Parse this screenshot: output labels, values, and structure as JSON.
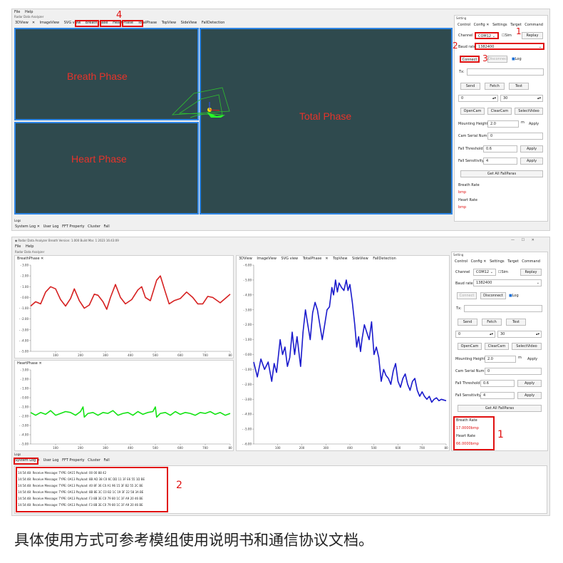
{
  "top": {
    "menu": [
      "File",
      "Help"
    ],
    "subtitle": "Radar Data Analyzer",
    "tabs": [
      "3DView",
      "ImageView",
      "SVG view",
      "BreathPhase",
      "HeartPhase",
      "TotalPhase",
      "TopView",
      "SideView",
      "FallDetection"
    ],
    "canvas_labels": {
      "breath": "Breath Phase",
      "heart": "Heart Phase",
      "total": "Total Phase"
    },
    "ann": {
      "n1": "1",
      "n2": "2",
      "n3": "3",
      "n4": "4"
    },
    "right": {
      "title": "Setting",
      "tabs": [
        "Control",
        "Config",
        "Settings",
        "Target",
        "Command"
      ],
      "channel_label": "Channel",
      "channel_value": "COM12",
      "sim": "Sim",
      "replay": "Replay",
      "baud_label": "Baud rate",
      "baud_value": "1382400",
      "connect": "Connect",
      "disconnect": "Disconnect",
      "log": "Log",
      "tx": "Tx:",
      "send": "Send",
      "fetch": "Fetch",
      "test": "Test",
      "num1": "0",
      "num2": "30",
      "opencam": "OpenCam",
      "clearcam": "ClearCam",
      "selectvideo": "SelectVideo",
      "mount_label": "Mounting Height",
      "mount_value": "2.0",
      "mount_unit": "m",
      "apply": "Apply",
      "camserial_label": "Cam Serial Num",
      "camserial_value": "0",
      "fallth_label": "Fall Threshold",
      "fallth_value": "0.6",
      "fallsens_label": "Fall Sensitivity",
      "fallsens_value": "4",
      "getall": "Get All FallParas",
      "breath_rate": "Breath Rate",
      "breath_unit": "bmp",
      "heart_rate": "Heart Rate",
      "heart_unit": "bmp"
    },
    "logs_title": "Logs",
    "log_tabs": [
      "System Log",
      "User Log",
      "FFT Property",
      "Cluster",
      "Fall"
    ]
  },
  "bottom": {
    "window_title": "Radar Data Analyzer Breath Version: 1.000 Build Mar. 1 2023 16:43:09",
    "menu": [
      "File",
      "Help"
    ],
    "subtitle": "Radar Data Analyzer",
    "breath_tab": "BreathPhase",
    "heart_tab": "HeartPhase",
    "center_tabs": [
      "3DView",
      "ImageView",
      "SVG view",
      "TotalPhase",
      "TopView",
      "SideView",
      "FallDetection"
    ],
    "yticks_breath": [
      "3.00",
      "2.00",
      "1.00",
      "0.00",
      "-1.00",
      "-2.00",
      "-3.00",
      "-4.00",
      "-5.00"
    ],
    "yticks_heart": [
      "3.00",
      "2.00",
      "1.00",
      "0.00",
      "-1.00",
      "-2.00",
      "-3.00",
      "-4.00",
      "-5.00"
    ],
    "yticks_total": [
      "6.00",
      "5.00",
      "4.00",
      "3.00",
      "2.00",
      "1.00",
      "0.00",
      "-1.00",
      "-2.00",
      "-3.00",
      "-4.00",
      "-5.00",
      "-6.00"
    ],
    "xticks": [
      "100",
      "200",
      "300",
      "400",
      "500",
      "600",
      "700",
      "80"
    ],
    "xticks_total": [
      "100",
      "200",
      "300",
      "400",
      "500",
      "600",
      "700",
      "80"
    ],
    "right": {
      "title": "Setting",
      "tabs": [
        "Control",
        "Config",
        "Settings",
        "Target",
        "Command"
      ],
      "channel_label": "Channel",
      "channel_value": "COM12",
      "sim": "Sim",
      "replay": "Replay",
      "baud_label": "Baud rate",
      "baud_value": "1382400",
      "connect": "Connect",
      "disconnect": "Disconnect",
      "log": "Log",
      "tx": "Tx:",
      "send": "Send",
      "fetch": "Fetch",
      "test": "Test",
      "num1": "0",
      "num2": "30",
      "opencam": "OpenCam",
      "clearcam": "ClearCam",
      "selectvideo": "SelectVideo",
      "mount_label": "Mounting Height",
      "mount_value": "2.0",
      "mount_unit": "m",
      "apply": "Apply",
      "camserial_label": "Cam Serial Num",
      "camserial_value": "0",
      "fallth_label": "Fall Threshold",
      "fallth_value": "0.6",
      "fallsens_label": "Fall Sensitivity",
      "fallsens_value": "4",
      "getall": "Get All FallParas",
      "breath_rate": "Breath Rate",
      "breath_value": "17.0000bmp",
      "heart_rate": "Heart Rate",
      "heart_value": "66.0000bmp"
    },
    "ann": {
      "n1": "1",
      "n2": "2"
    },
    "logs_title": "Logs",
    "log_tabs": [
      "System Log",
      "User Log",
      "FFT Property",
      "Cluster",
      "Fall"
    ],
    "log_lines": [
      "14:54:48: Receive Message: TYPE: 0A15 Payload: 00 00 88 42",
      "14:54:48: Receive Message: TYPE: 0A13 Payload: 8B AD 38 C0 6C DD 11 3F E6 55 1D BE",
      "14:54:48: Receive Message: TYPE: 0A13 Payload: 40 8F 36 C0 A1 96 15 3F B2 55 2C BE",
      "14:54:48: Receive Message: TYPE: 0A13 Payload: 8B 8E 3C C0 B2 1C 19 3F 22 58 3A BE",
      "14:54:48: Receive Message: TYPE: 0A13 Payload: F3 8B 3E C0 79 80 1C 3F A9 20 46 BE",
      "14:54:48: Receive Message: TYPE: 0A13 Payload: F3 8B 3E C0 79 80 1C 3F A9 20 46 BE"
    ]
  },
  "caption": "具体使用方式可参考模组使用说明书和通信协议文档。",
  "colors": {
    "breath_line": "#d62020",
    "heart_line": "#13e313",
    "total_line": "#1a1acc",
    "canvas_bg": "#2f4a4e",
    "highlight": "#2f86e6",
    "annotation": "#e01010"
  },
  "chart_data": [
    {
      "type": "line",
      "title": "",
      "ylim": [
        -5,
        3
      ],
      "xlim": [
        0,
        800
      ],
      "xticks": [
        100,
        200,
        300,
        400,
        500,
        600,
        700,
        800
      ],
      "series": [
        {
          "values": [
            [
              0,
              -0.8
            ],
            [
              20,
              -0.4
            ],
            [
              40,
              -0.6
            ],
            [
              60,
              0.5
            ],
            [
              80,
              1.0
            ],
            [
              100,
              0.8
            ],
            [
              120,
              -0.2
            ],
            [
              140,
              -0.8
            ],
            [
              160,
              -0.1
            ],
            [
              175,
              0.8
            ],
            [
              195,
              -0.3
            ],
            [
              215,
              -1.0
            ],
            [
              235,
              -0.7
            ],
            [
              255,
              0.3
            ],
            [
              270,
              0.2
            ],
            [
              290,
              -0.4
            ],
            [
              305,
              -1.1
            ],
            [
              320,
              0.0
            ],
            [
              340,
              1.2
            ],
            [
              360,
              0.0
            ],
            [
              380,
              -0.6
            ],
            [
              405,
              -0.2
            ],
            [
              430,
              0.7
            ],
            [
              445,
              1.0
            ],
            [
              460,
              0.0
            ],
            [
              480,
              -0.3
            ],
            [
              505,
              1.6
            ],
            [
              520,
              2.0
            ],
            [
              540,
              0.5
            ],
            [
              555,
              -0.6
            ],
            [
              575,
              -0.3
            ],
            [
              600,
              -0.1
            ],
            [
              625,
              0.5
            ],
            [
              650,
              0.0
            ],
            [
              670,
              -0.6
            ],
            [
              690,
              -0.6
            ],
            [
              710,
              0.1
            ],
            [
              730,
              0.0
            ],
            [
              760,
              -0.5
            ],
            [
              780,
              -0.1
            ],
            [
              800,
              0.3
            ]
          ]
        }
      ]
    },
    {
      "type": "line",
      "title": "",
      "ylim": [
        -5,
        3
      ],
      "xlim": [
        0,
        800
      ],
      "xticks": [
        100,
        200,
        300,
        400,
        500,
        600,
        700,
        800
      ],
      "series": [
        {
          "values": [
            [
              0,
              -1.6
            ],
            [
              20,
              -1.9
            ],
            [
              40,
              -1.6
            ],
            [
              60,
              -1.8
            ],
            [
              80,
              -1.4
            ],
            [
              100,
              -1.9
            ],
            [
              120,
              -1.7
            ],
            [
              140,
              -1.5
            ],
            [
              160,
              -1.6
            ],
            [
              180,
              -1.9
            ],
            [
              200,
              -1.5
            ],
            [
              210,
              -1.0
            ],
            [
              215,
              -2.1
            ],
            [
              230,
              -1.7
            ],
            [
              250,
              -1.6
            ],
            [
              270,
              -1.9
            ],
            [
              290,
              -1.6
            ],
            [
              310,
              -1.7
            ],
            [
              330,
              -1.4
            ],
            [
              350,
              -1.9
            ],
            [
              370,
              -1.7
            ],
            [
              390,
              -1.6
            ],
            [
              410,
              -1.9
            ],
            [
              430,
              -1.5
            ],
            [
              450,
              -1.8
            ],
            [
              470,
              -1.6
            ],
            [
              490,
              -1.5
            ],
            [
              500,
              -1.0
            ],
            [
              505,
              -2.1
            ],
            [
              520,
              -1.7
            ],
            [
              540,
              -1.6
            ],
            [
              560,
              -1.9
            ],
            [
              580,
              -1.5
            ],
            [
              600,
              -1.8
            ],
            [
              620,
              -1.6
            ],
            [
              640,
              -1.7
            ],
            [
              660,
              -1.9
            ],
            [
              680,
              -1.6
            ],
            [
              700,
              -1.7
            ],
            [
              720,
              -1.5
            ],
            [
              740,
              -1.8
            ],
            [
              760,
              -1.6
            ],
            [
              780,
              -1.9
            ],
            [
              800,
              -1.7
            ]
          ]
        }
      ]
    },
    {
      "type": "line",
      "title": "",
      "ylim": [
        -6,
        6
      ],
      "xlim": [
        0,
        800
      ],
      "xticks": [
        100,
        200,
        300,
        400,
        500,
        600,
        700,
        800
      ],
      "series": [
        {
          "values": [
            [
              0,
              -0.5
            ],
            [
              15,
              -1.5
            ],
            [
              30,
              -0.3
            ],
            [
              45,
              -1.0
            ],
            [
              60,
              -0.5
            ],
            [
              75,
              -1.8
            ],
            [
              85,
              -0.6
            ],
            [
              95,
              -1.2
            ],
            [
              110,
              1.0
            ],
            [
              120,
              0.0
            ],
            [
              130,
              0.5
            ],
            [
              140,
              -0.8
            ],
            [
              150,
              -0.2
            ],
            [
              160,
              1.5
            ],
            [
              170,
              0.0
            ],
            [
              180,
              1.2
            ],
            [
              195,
              -0.8
            ],
            [
              205,
              1.5
            ],
            [
              215,
              3.0
            ],
            [
              225,
              2.0
            ],
            [
              235,
              1.0
            ],
            [
              245,
              2.8
            ],
            [
              255,
              3.5
            ],
            [
              265,
              3.0
            ],
            [
              275,
              2.0
            ],
            [
              285,
              1.0
            ],
            [
              295,
              2.0
            ],
            [
              305,
              3.0
            ],
            [
              315,
              3.2
            ],
            [
              325,
              4.5
            ],
            [
              332,
              4.0
            ],
            [
              340,
              5.0
            ],
            [
              348,
              4.2
            ],
            [
              355,
              4.8
            ],
            [
              365,
              4.5
            ],
            [
              375,
              4.3
            ],
            [
              385,
              5.0
            ],
            [
              392,
              4.3
            ],
            [
              400,
              4.7
            ],
            [
              410,
              3.5
            ],
            [
              420,
              2.0
            ],
            [
              428,
              0.5
            ],
            [
              436,
              1.2
            ],
            [
              444,
              0.2
            ],
            [
              450,
              1.0
            ],
            [
              460,
              2.0
            ],
            [
              470,
              1.5
            ],
            [
              480,
              1.0
            ],
            [
              490,
              2.2
            ],
            [
              500,
              0.0
            ],
            [
              510,
              0.5
            ],
            [
              520,
              -0.2
            ],
            [
              530,
              -1.8
            ],
            [
              540,
              -1.0
            ],
            [
              550,
              -1.4
            ],
            [
              560,
              -1.6
            ],
            [
              570,
              -2.0
            ],
            [
              580,
              -1.1
            ],
            [
              590,
              -0.6
            ],
            [
              600,
              -1.8
            ],
            [
              610,
              -2.2
            ],
            [
              620,
              -1.6
            ],
            [
              630,
              -1.3
            ],
            [
              640,
              -2.0
            ],
            [
              650,
              -2.4
            ],
            [
              660,
              -1.8
            ],
            [
              670,
              -1.6
            ],
            [
              680,
              -2.4
            ],
            [
              690,
              -2.8
            ],
            [
              700,
              -2.5
            ],
            [
              710,
              -2.8
            ],
            [
              720,
              -3.0
            ],
            [
              730,
              -2.8
            ],
            [
              740,
              -3.2
            ],
            [
              750,
              -3.0
            ],
            [
              760,
              -2.9
            ],
            [
              770,
              -3.1
            ],
            [
              780,
              -3.0
            ],
            [
              800,
              -3.1
            ]
          ]
        }
      ]
    }
  ]
}
